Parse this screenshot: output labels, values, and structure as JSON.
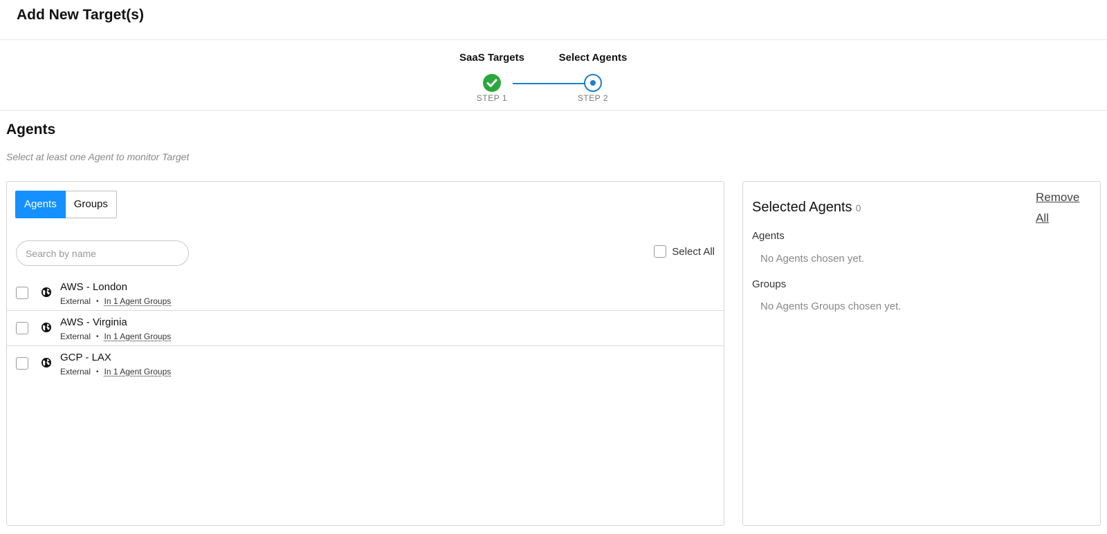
{
  "header": {
    "title": "Add New Target(s)"
  },
  "stepper": {
    "steps": [
      {
        "title": "SaaS Targets",
        "caption": "STEP 1",
        "state": "complete"
      },
      {
        "title": "Select Agents",
        "caption": "STEP 2",
        "state": "current"
      }
    ],
    "colors": {
      "complete": "#2aa83c",
      "current": "#1a7fcc"
    }
  },
  "section": {
    "title": "Agents",
    "subtitle": "Select at least one Agent to monitor Target"
  },
  "tabs": [
    {
      "label": "Agents",
      "active": true
    },
    {
      "label": "Groups",
      "active": false
    }
  ],
  "search": {
    "placeholder": "Search by name",
    "value": ""
  },
  "select_all": {
    "label": "Select All",
    "checked": false
  },
  "agents": [
    {
      "name": "AWS - London",
      "type": "External",
      "groups": "In 1 Agent Groups",
      "icon": "globe-icon"
    },
    {
      "name": "AWS - Virginia",
      "type": "External",
      "groups": "In 1 Agent Groups",
      "icon": "globe-icon"
    },
    {
      "name": "GCP - LAX",
      "type": "External",
      "groups": "In 1 Agent Groups",
      "icon": "globe-icon"
    }
  ],
  "selected": {
    "title": "Selected Agents",
    "count": "0",
    "remove_all": "Remove All",
    "agents_heading": "Agents",
    "agents_empty": "No Agents chosen yet.",
    "groups_heading": "Groups",
    "groups_empty": "No Agents Groups chosen yet."
  },
  "accent": "#1590ff"
}
